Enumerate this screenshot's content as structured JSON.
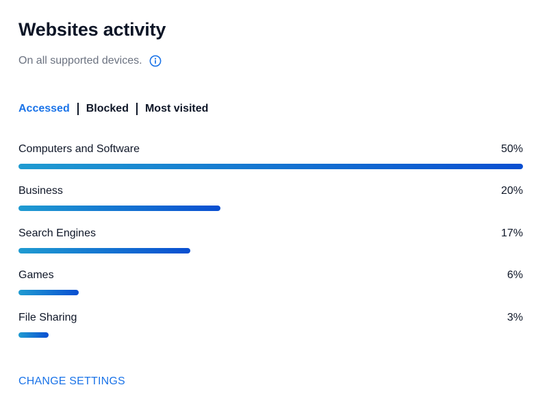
{
  "header": {
    "title": "Websites activity",
    "subtitle": "On all supported devices.",
    "info_icon": "info-circle-icon"
  },
  "tabs": [
    {
      "label": "Accessed",
      "active": true
    },
    {
      "label": "Blocked",
      "active": false
    },
    {
      "label": "Most visited",
      "active": false
    }
  ],
  "colors": {
    "accent": "#1a73e8",
    "bar_gradient_start": "#1f9bd1",
    "bar_gradient_end": "#0a4fd1",
    "text": "#0e1627",
    "muted": "#6b7280"
  },
  "categories": [
    {
      "label": "Computers and Software",
      "percent_label": "50%",
      "percent": 50
    },
    {
      "label": "Business",
      "percent_label": "20%",
      "percent": 20
    },
    {
      "label": "Search Engines",
      "percent_label": "17%",
      "percent": 17
    },
    {
      "label": "Games",
      "percent_label": "6%",
      "percent": 6
    },
    {
      "label": "File Sharing",
      "percent_label": "3%",
      "percent": 3
    }
  ],
  "footer": {
    "change_settings": "CHANGE SETTINGS"
  }
}
